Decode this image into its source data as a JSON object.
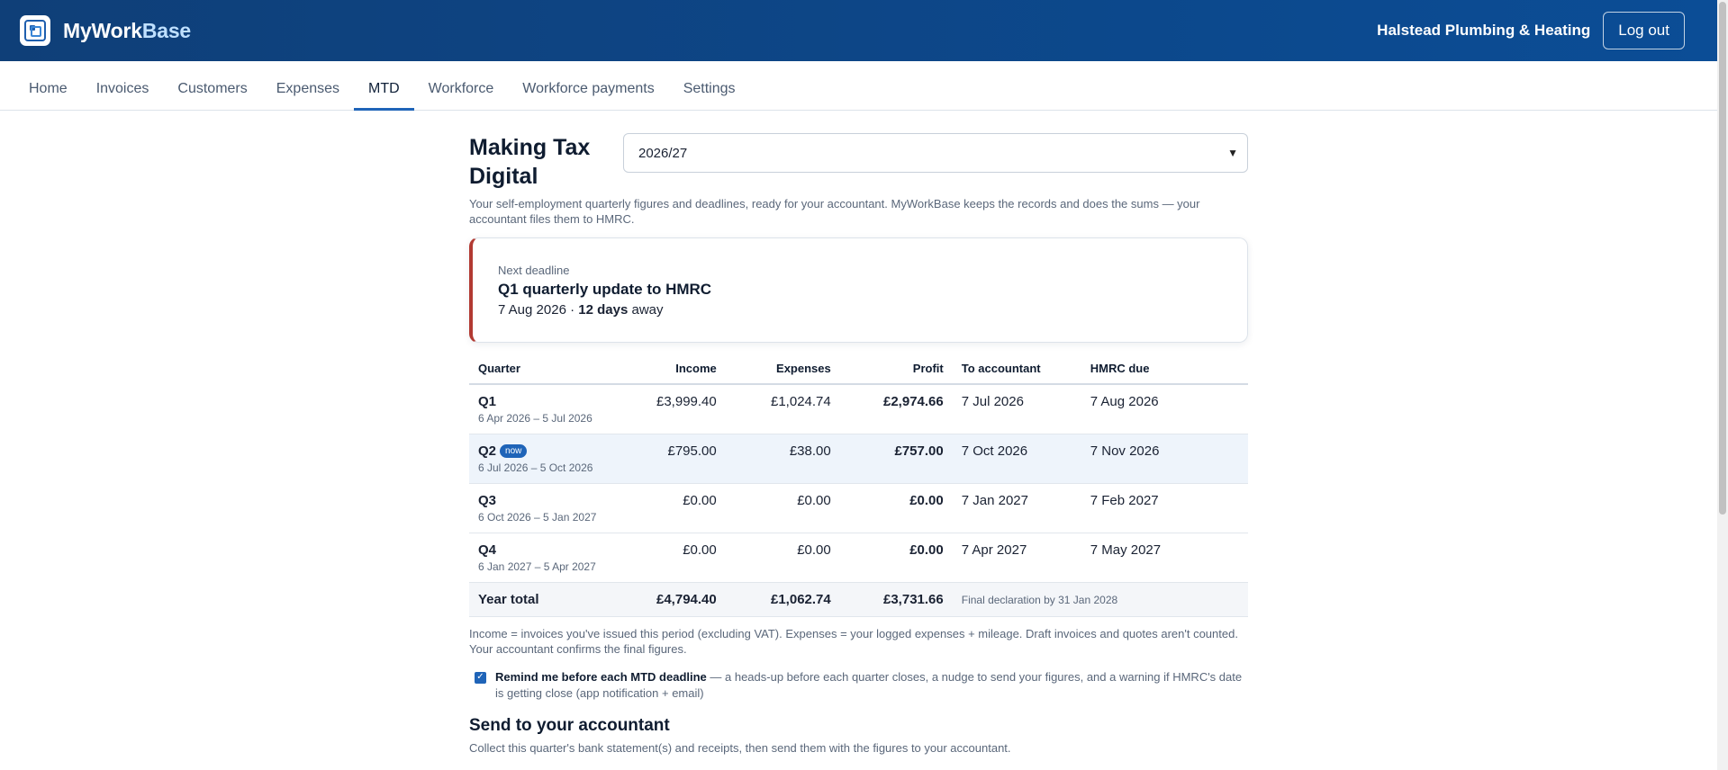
{
  "header": {
    "brand_prefix": "MyWork",
    "brand_suffix": "Base",
    "business_name": "Halstead Plumbing & Heating",
    "logout_label": "Log out",
    "logo_icon": "app-logo-icon"
  },
  "nav": {
    "items": [
      "Home",
      "Invoices",
      "Customers",
      "Expenses",
      "MTD",
      "Workforce",
      "Workforce payments",
      "Settings"
    ],
    "active": "MTD"
  },
  "page": {
    "title": "Making Tax Digital",
    "year_selected": "2026/27",
    "intro": "Your self-employment quarterly figures and deadlines, ready for your accountant. MyWorkBase keeps the records and does the sums — your accountant files them to HMRC."
  },
  "deadline": {
    "label": "Next deadline",
    "title": "Q1 quarterly update to HMRC",
    "date": "7 Aug 2026",
    "separator": " · ",
    "days": "12 days",
    "suffix": " away",
    "accent_color": "#b23a32"
  },
  "table": {
    "headers": {
      "quarter": "Quarter",
      "income": "Income",
      "expenses": "Expenses",
      "profit": "Profit",
      "to_accountant": "To accountant",
      "hmrc_due": "HMRC due"
    },
    "rows": [
      {
        "name": "Q1",
        "badge": "",
        "range": "6 Apr 2026 – 5 Jul 2026",
        "income": "£3,999.40",
        "expenses": "£1,024.74",
        "profit": "£2,974.66",
        "to_accountant": "7 Jul 2026",
        "hmrc_due": "7 Aug 2026"
      },
      {
        "name": "Q2",
        "badge": "now",
        "range": "6 Jul 2026 – 5 Oct 2026",
        "income": "£795.00",
        "expenses": "£38.00",
        "profit": "£757.00",
        "to_accountant": "7 Oct 2026",
        "hmrc_due": "7 Nov 2026"
      },
      {
        "name": "Q3",
        "badge": "",
        "range": "6 Oct 2026 – 5 Jan 2027",
        "income": "£0.00",
        "expenses": "£0.00",
        "profit": "£0.00",
        "to_accountant": "7 Jan 2027",
        "hmrc_due": "7 Feb 2027"
      },
      {
        "name": "Q4",
        "badge": "",
        "range": "6 Jan 2027 – 5 Apr 2027",
        "income": "£0.00",
        "expenses": "£0.00",
        "profit": "£0.00",
        "to_accountant": "7 Apr 2027",
        "hmrc_due": "7 May 2027"
      }
    ],
    "total": {
      "label": "Year total",
      "income": "£4,794.40",
      "expenses": "£1,062.74",
      "profit": "£3,731.66",
      "note": "Final declaration by 31 Jan 2028"
    }
  },
  "footnote": "Income = invoices you've issued this period (excluding VAT). Expenses = your logged expenses + mileage. Draft invoices and quotes aren't counted. Your accountant confirms the final figures.",
  "reminder": {
    "checked": true,
    "label": "Remind me before each MTD deadline",
    "description": " — a heads-up before each quarter closes, a nudge to send your figures, and a warning if HMRC's date is getting close (app notification + email)"
  },
  "send": {
    "title": "Send to your accountant",
    "description": "Collect this quarter's bank statement(s) and receipts, then send them with the figures to your accountant."
  }
}
